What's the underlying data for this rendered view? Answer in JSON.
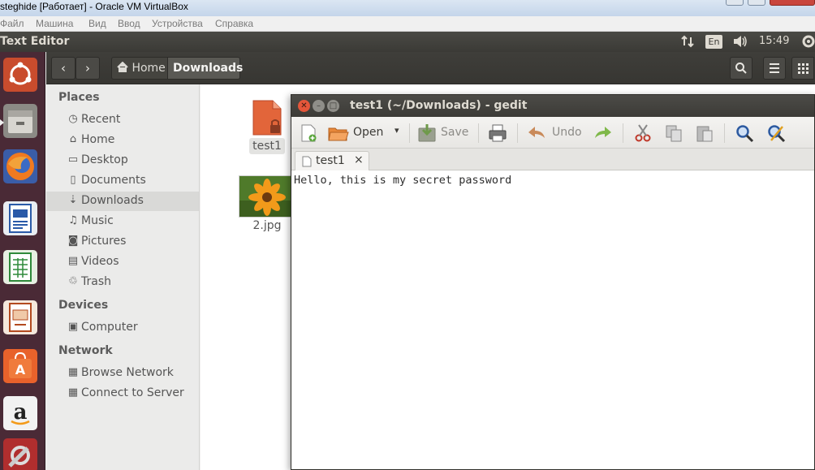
{
  "vbox": {
    "title": "steghide [Работает] - Oracle VM VirtualBox",
    "menu": [
      "Файл",
      "Машина",
      "Вид",
      "Ввод",
      "Устройства",
      "Справка"
    ]
  },
  "panel": {
    "app_name": "Text Editor",
    "lang": "En",
    "clock": "15:49"
  },
  "launcher": {
    "items": [
      "ubuntu-dash",
      "files",
      "firefox",
      "libreoffice-writer",
      "libreoffice-calc",
      "libreoffice-impress",
      "ubuntu-software-center",
      "amazon",
      "system-settings"
    ]
  },
  "nautilus": {
    "breadcrumb": {
      "home": "Home",
      "current": "Downloads"
    },
    "sidebar": {
      "places_header": "Places",
      "places": [
        {
          "label": "Recent",
          "icon": "clock-icon"
        },
        {
          "label": "Home",
          "icon": "home-icon"
        },
        {
          "label": "Desktop",
          "icon": "folder-icon"
        },
        {
          "label": "Documents",
          "icon": "document-icon"
        },
        {
          "label": "Downloads",
          "icon": "download-icon"
        },
        {
          "label": "Music",
          "icon": "music-icon"
        },
        {
          "label": "Pictures",
          "icon": "camera-icon"
        },
        {
          "label": "Videos",
          "icon": "film-icon"
        },
        {
          "label": "Trash",
          "icon": "trash-icon"
        }
      ],
      "devices_header": "Devices",
      "devices": [
        {
          "label": "Computer",
          "icon": "drive-icon"
        }
      ],
      "network_header": "Network",
      "network": [
        {
          "label": "Browse Network",
          "icon": "network-icon"
        },
        {
          "label": "Connect to Server",
          "icon": "server-icon"
        }
      ]
    },
    "files": [
      {
        "name": "test1",
        "type": "document"
      },
      {
        "name": "2.jpg",
        "type": "image"
      }
    ]
  },
  "gedit": {
    "title": "test1 (~/Downloads) - gedit",
    "toolbar": {
      "open": "Open",
      "save": "Save",
      "undo": "Undo"
    },
    "tab_label": "test1",
    "tab_close": "×",
    "content": "Hello, this is my secret password"
  }
}
